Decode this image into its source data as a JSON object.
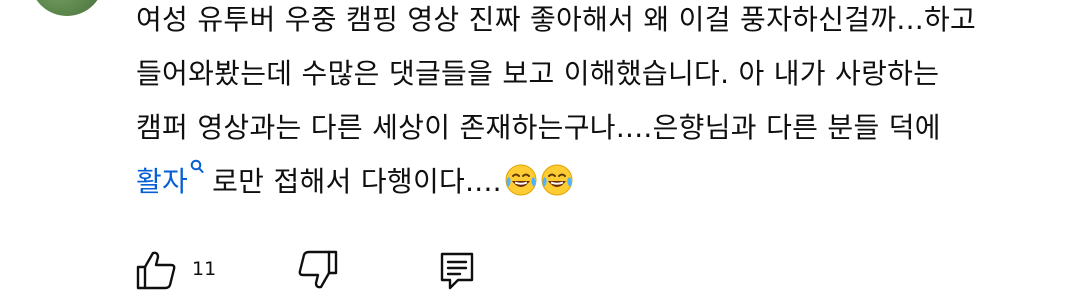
{
  "comment": {
    "line1": "여성 유투버 우중 캠핑 영상 진짜 좋아해서 왜 이걸 풍자하신걸까...하고",
    "line2": "들어와봤는데 수많은 댓글들을 보고 이해했습니다. 아 내가 사랑하는",
    "line3": "캠퍼 영상과는 다른 세상이 존재하는구나....은향님과 다른 분들 덕에",
    "link_text": "활자",
    "line4_rest": "로만 접해서 다행이다....",
    "emojis": [
      "face-with-tears-of-joy",
      "face-with-tears-of-joy"
    ]
  },
  "actions": {
    "like_count": "11",
    "icons": {
      "like": "thumbs-up-icon",
      "dislike": "thumbs-down-icon",
      "reply": "reply-comment-icon"
    }
  },
  "colors": {
    "text": "#0f0f0f",
    "link": "#065fd4",
    "background": "#ffffff"
  }
}
